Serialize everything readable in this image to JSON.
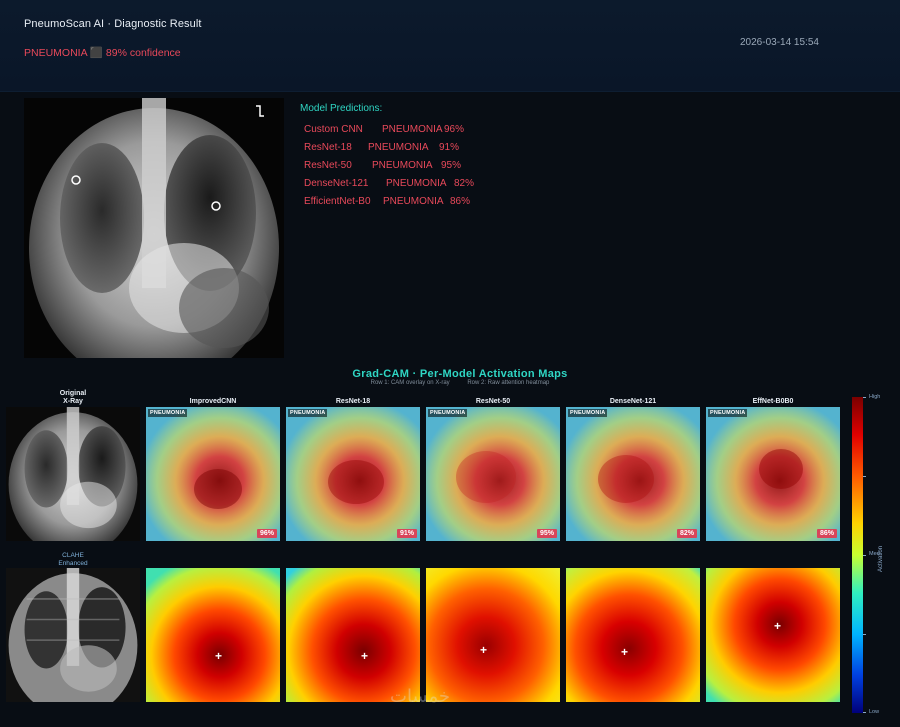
{
  "header": {
    "title": "PneumoScan AI · Diagnostic Result",
    "verdict": "PNEUMONIA ⬛ 89% confidence",
    "timestamp": "2026-03-14 15:54"
  },
  "predictions": {
    "title": "Model Predictions:",
    "rows": [
      {
        "model": "Custom CNN",
        "label": "PNEUMONIA",
        "confidence": "96%"
      },
      {
        "model": "ResNet-18",
        "label": "PNEUMONIA",
        "confidence": "91%"
      },
      {
        "model": "ResNet-50",
        "label": "PNEUMONIA",
        "confidence": "95%"
      },
      {
        "model": "DenseNet-121",
        "label": "PNEUMONIA",
        "confidence": "82%"
      },
      {
        "model": "EfficientNet-B0",
        "label": "PNEUMONIA",
        "confidence": "86%"
      }
    ]
  },
  "gradcam": {
    "title": "Grad-CAM  ·  Per-Model Activation Maps",
    "subtitle_row1": "Row 1: CAM overlay on X-ray",
    "subtitle_row2": "Row 2: Raw attention heatmap",
    "col_original_line1": "Original",
    "col_original_line2": "X-Ray",
    "row2_line1": "CLAHE",
    "row2_line2": "Enhanced",
    "models": [
      {
        "name": "ImprovedCNN",
        "tag": "PNEUMONIA",
        "pct": "96%"
      },
      {
        "name": "ResNet-18",
        "tag": "PNEUMONIA",
        "pct": "91%"
      },
      {
        "name": "ResNet-50",
        "tag": "PNEUMONIA",
        "pct": "95%"
      },
      {
        "name": "DenseNet-121",
        "tag": "PNEUMONIA",
        "pct": "82%"
      },
      {
        "name": "EffNet-B0B0",
        "tag": "PNEUMONIA",
        "pct": "86%"
      }
    ],
    "colorbar": {
      "high": "High",
      "med": "Med",
      "low": "Low",
      "title": "Activation"
    }
  },
  "colors": {
    "accent": "#2fd6c4",
    "alert": "#e8495a",
    "background": "#080d14"
  },
  "watermark": "خمسات"
}
